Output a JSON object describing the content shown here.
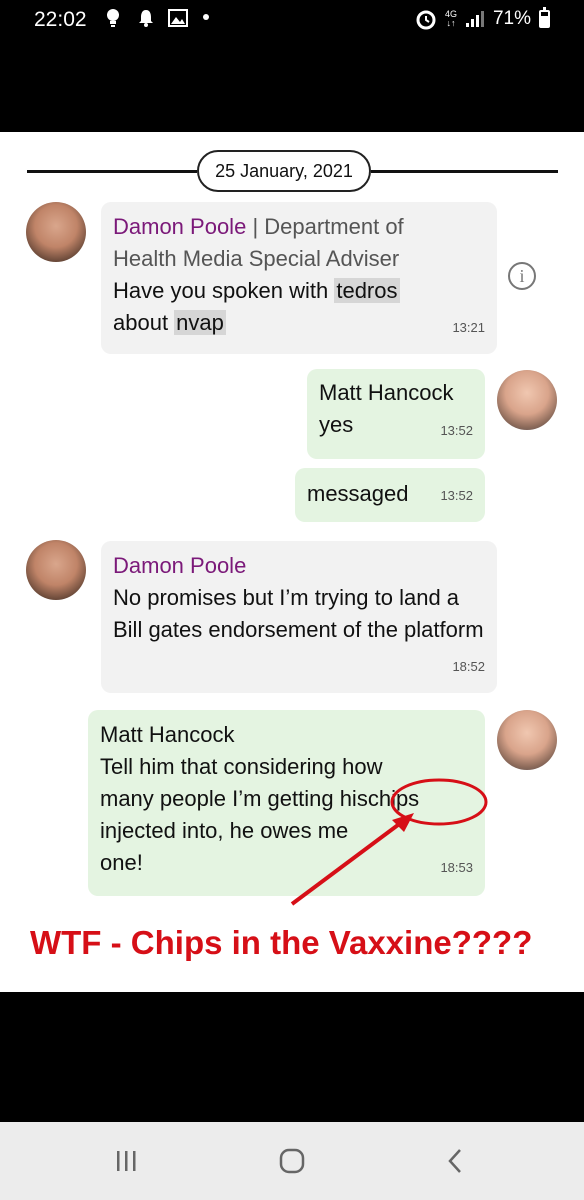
{
  "status_bar": {
    "time": "22:02",
    "network": "4G",
    "battery": "71%",
    "icons": [
      "lightbulb-icon",
      "notification-icon",
      "gallery-icon",
      "dot-icon",
      "alarm-icon",
      "signal-icon",
      "battery-icon"
    ]
  },
  "chat": {
    "date": "25 January, 2021",
    "messages": [
      {
        "sender": "Damon Poole",
        "role": "| Department of Health Media Special Adviser",
        "text_before": "Have you spoken with ",
        "highlight1": "tedros",
        "text_mid": "about ",
        "highlight2": "nvap",
        "time": "13:21"
      },
      {
        "sender": "Matt Hancock",
        "text": "yes",
        "time": "13:52"
      },
      {
        "text": "messaged",
        "time": "13:52"
      },
      {
        "sender": "Damon Poole",
        "text": "No promises but I’m trying to land a Bill gates endorsement of the platform",
        "time": "18:52"
      },
      {
        "sender": "Matt Hancock",
        "text_line1": "Tell him that considering how",
        "text_line2a": "many people I’m getting his",
        "text_line2b": "chips",
        "text_line3": "injected into, he owes me",
        "text_line4": "one!",
        "time": "18:53"
      }
    ]
  },
  "caption": "WTF  -  Chips in the Vaxxine????",
  "colors": {
    "sender_name": "#7b1979",
    "incoming_bubble": "#f2f2f2",
    "outgoing_bubble": "#e4f4e1",
    "annotation": "#d60f17"
  },
  "nav_bar": {
    "buttons": [
      "recent-apps-icon",
      "home-icon",
      "back-icon"
    ]
  }
}
